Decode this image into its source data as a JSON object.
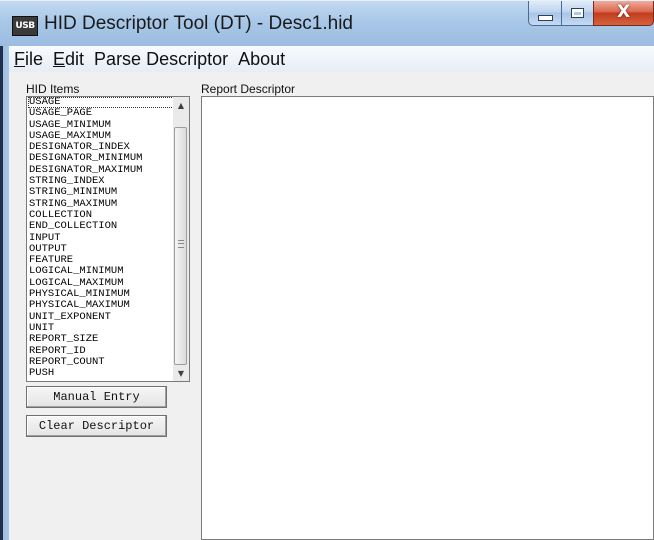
{
  "window": {
    "app_icon_text": "USB",
    "title": "HID Descriptor Tool (DT) - Desc1.hid",
    "controls": {
      "minimize": "minimize",
      "maximize": "maximize",
      "close": "X"
    }
  },
  "menu": {
    "items": [
      {
        "mnemonic": "F",
        "rest": "ile"
      },
      {
        "mnemonic": "E",
        "rest": "dit"
      },
      {
        "mnemonic": "",
        "rest": "Parse Descriptor"
      },
      {
        "mnemonic": "",
        "rest": "About"
      }
    ]
  },
  "hid_items": {
    "label": "HID Items",
    "items": [
      "USAGE",
      "USAGE_PAGE",
      "USAGE_MINIMUM",
      "USAGE_MAXIMUM",
      "DESIGNATOR_INDEX",
      "DESIGNATOR_MINIMUM",
      "DESIGNATOR_MAXIMUM",
      "STRING_INDEX",
      "STRING_MINIMUM",
      "STRING_MAXIMUM",
      "COLLECTION",
      "END_COLLECTION",
      "INPUT",
      "OUTPUT",
      "FEATURE",
      "LOGICAL_MINIMUM",
      "LOGICAL_MAXIMUM",
      "PHYSICAL_MINIMUM",
      "PHYSICAL_MAXIMUM",
      "UNIT_EXPONENT",
      "UNIT",
      "REPORT_SIZE",
      "REPORT_ID",
      "REPORT_COUNT",
      "PUSH"
    ],
    "selected_index": 0
  },
  "buttons": {
    "manual_entry": "Manual Entry",
    "clear_descriptor": "Clear Descriptor"
  },
  "report": {
    "label": "Report Descriptor",
    "content": ""
  },
  "icons": {
    "scroll_up": "scroll-up-arrow",
    "scroll_down": "scroll-down-arrow"
  }
}
